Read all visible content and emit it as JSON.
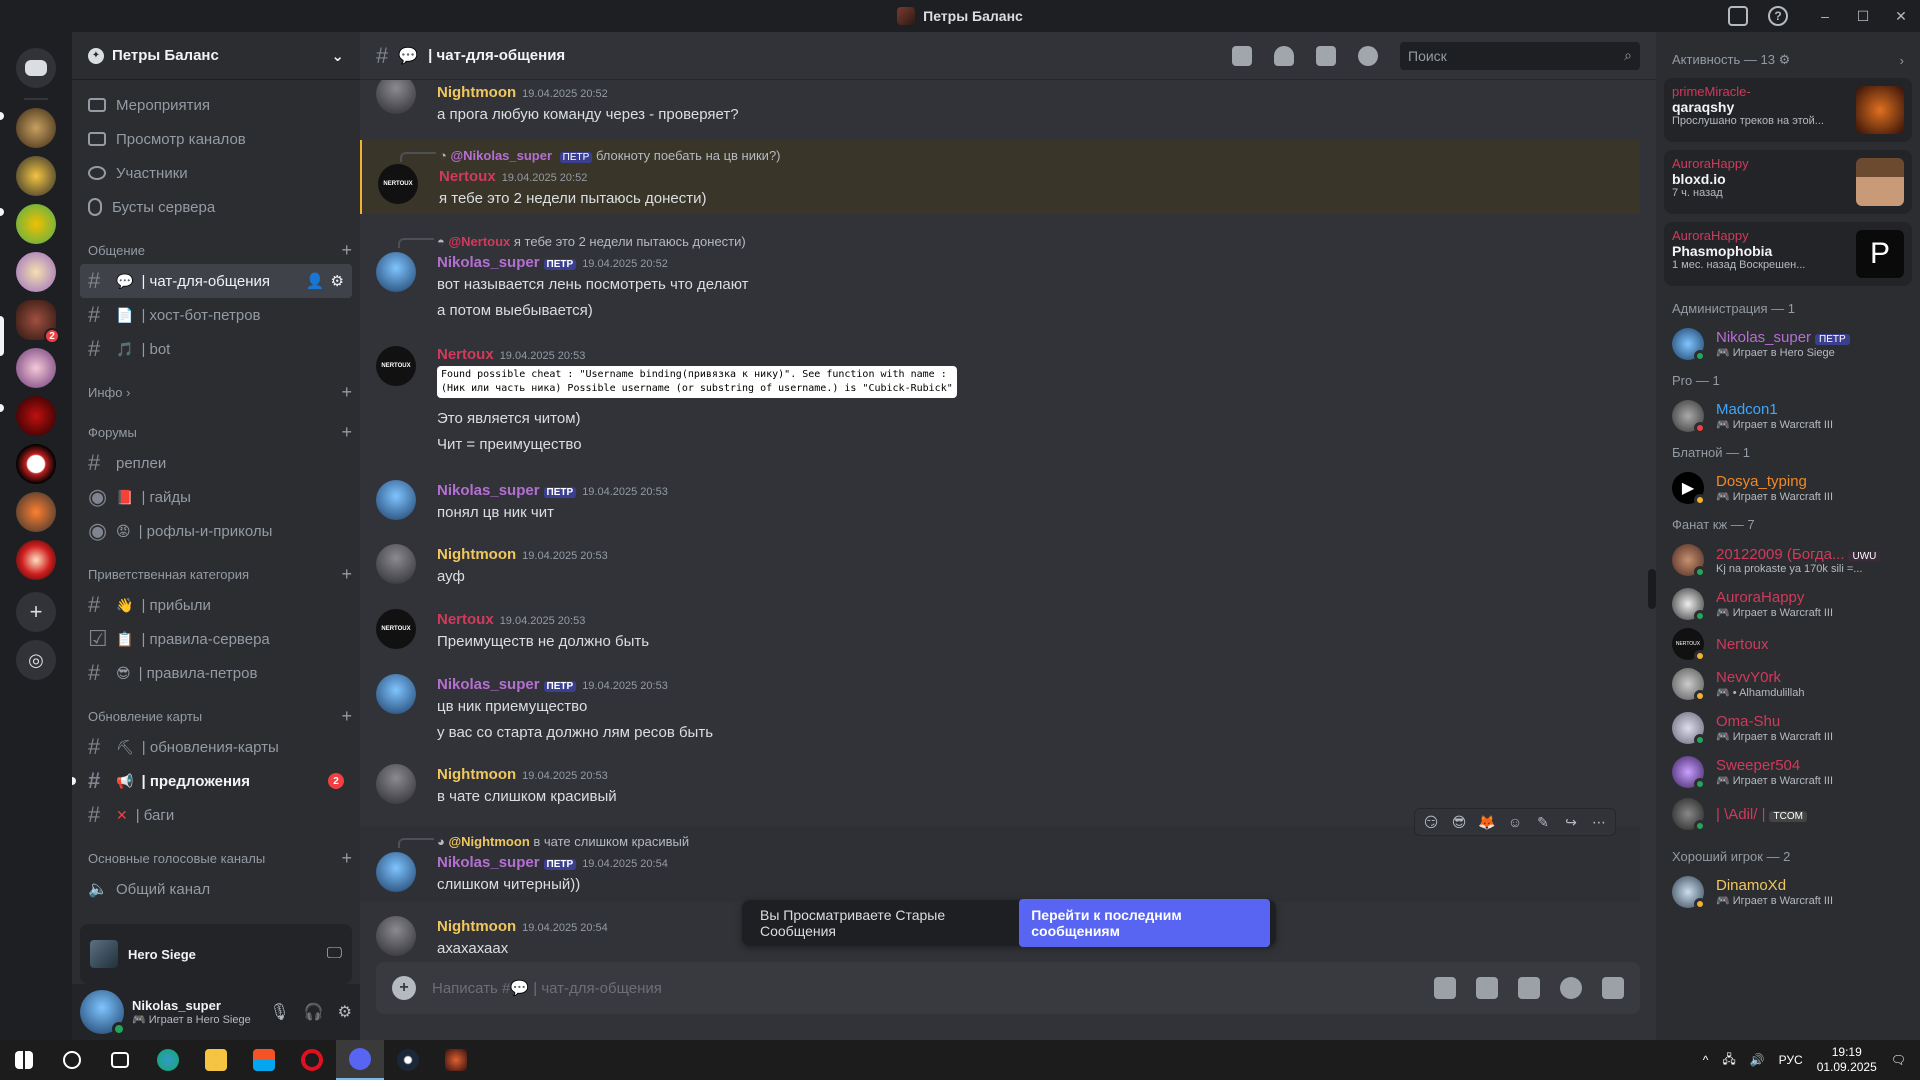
{
  "window": {
    "title": "Петры Баланс"
  },
  "guild": {
    "name": "Петры Баланс"
  },
  "nav": [
    "Мероприятия",
    "Просмотр каналов",
    "Участники",
    "Бусты сервера"
  ],
  "categories": {
    "c1": "Общение",
    "c2": "Инфо",
    "c3": "Форумы",
    "c4": "Приветственная категория",
    "c5": "Обновление карты",
    "c6": "Основные голосовые каналы"
  },
  "channels": {
    "chat": "| чат-для-общения",
    "host": "| хост-бот-петров",
    "bot": "| bot",
    "replays": "реплеи",
    "guides": "| гайды",
    "jokes": "| рофлы-и-приколы",
    "arrived": "| прибыли",
    "rules": "| правила-сервера",
    "rules_petrov": "| правила-петров",
    "map_updates": "| обновления-карты",
    "suggestions": "предложения",
    "suggestions_count": "2",
    "bugs": "| баги",
    "voice_general": "Общий канал"
  },
  "voice_bar": {
    "game": "Hero Siege"
  },
  "user": {
    "name": "Nikolas_super",
    "status": "Играет в Hero Siege"
  },
  "chat_header": {
    "channel": "| чат-для-общения",
    "search_placeholder": "Поиск"
  },
  "messages": [
    {
      "author": "Nightmoon",
      "time": "19.04.2025 20:52",
      "lines": [
        "а прога любую команду через - проверяет?"
      ]
    },
    {
      "reply_to": "@Nikolas_super",
      "reply_text": "блокноту поебать на цв ники?)",
      "author": "Nertoux",
      "time": "19.04.2025 20:52",
      "lines": [
        "я тебе это 2 недели пытаюсь донести)"
      ]
    },
    {
      "reply_to": "@Nertoux",
      "reply_text": "я тебе это 2 недели пытаюсь донести)",
      "author": "Nikolas_super",
      "time": "19.04.2025 20:52",
      "lines": [
        "вот называется лень посмотреть что делают",
        "а потом выебывается)"
      ]
    },
    {
      "author": "Nertoux",
      "time": "19.04.2025 20:53",
      "code": [
        "Found possible cheat : \"Username binding(привязка к нику)\". See function with name :",
        "(Ник или часть ника) Possible username (or substring of username.) is \"Cubick-Rubick\""
      ],
      "lines": [
        "Это является читом)",
        "Чит = преимущество"
      ]
    },
    {
      "author": "Nikolas_super",
      "time": "19.04.2025 20:53",
      "lines": [
        "понял цв ник чит"
      ]
    },
    {
      "author": "Nightmoon",
      "time": "19.04.2025 20:53",
      "lines": [
        "ауф"
      ]
    },
    {
      "author": "Nertoux",
      "time": "19.04.2025 20:53",
      "lines": [
        "Преимуществ не должно быть"
      ]
    },
    {
      "author": "Nikolas_super",
      "time": "19.04.2025 20:53",
      "lines": [
        "цв ник приемущество",
        "у вас со старта должно лям ресов быть"
      ]
    },
    {
      "author": "Nightmoon",
      "time": "19.04.2025 20:53",
      "lines": [
        "в чате слишком красивый"
      ]
    },
    {
      "reply_to": "@Nightmoon",
      "reply_text": "в чате слишком красивый",
      "author": "Nikolas_super",
      "time": "19.04.2025 20:54",
      "lines": [
        "слишком читерный))"
      ]
    },
    {
      "author": "Nightmoon",
      "time": "19.04.2025 20:54",
      "lines": [
        "ахахахаах"
      ]
    }
  ],
  "user_tag": "ПЕТР",
  "jump_bar": {
    "text": "Вы Просматриваете Старые Сообщения",
    "button": "Перейти к последним сообщениям"
  },
  "composer": {
    "prefix": "Написать #",
    "placeholder": "| чат-для-общения"
  },
  "members": {
    "activity_header": "Активность — 13",
    "activities": [
      {
        "user": "primeMiracle-",
        "title": "qaraqshy",
        "sub": "Прослушано треков на этой..."
      },
      {
        "user": "AuroraHappy",
        "title": "bloxd.io",
        "sub": "7 ч. назад"
      },
      {
        "user": "AuroraHappy",
        "title": "Phasmophobia",
        "sub": "1 мес. назад  Воскрешен..."
      }
    ],
    "sections": [
      {
        "title": "Администрация — 1",
        "items": [
          {
            "name": "Nikolas_super",
            "tag": "ПЕТР",
            "sub": "Играет в Hero Siege",
            "color": "#b56fd2"
          }
        ]
      },
      {
        "title": "Pro — 1",
        "items": [
          {
            "name": "Madcon1",
            "sub": "Играет в Warcraft III",
            "color": "#3ea6ff"
          }
        ]
      },
      {
        "title": "Блатной — 1",
        "items": [
          {
            "name": "Dosya_typing",
            "sub": "Играет в Warcraft III",
            "color": "#f08a24"
          }
        ]
      },
      {
        "title": "Фанат кж — 7",
        "items": [
          {
            "name": "20122009 (Богда...",
            "tag": "UWU",
            "sub": "Kj na prokaste ya 170k sili =...",
            "color": "#d13a5b"
          },
          {
            "name": "AuroraHappy",
            "sub": "Играет в Warcraft III",
            "color": "#d13a5b"
          },
          {
            "name": "Nertoux",
            "sub": "",
            "color": "#d13a5b"
          },
          {
            "name": "NevvY0rk",
            "sub": "Alhamdulillah",
            "color": "#d13a5b"
          },
          {
            "name": "Oma-Shu",
            "sub": "Играет в Warcraft III",
            "color": "#d13a5b"
          },
          {
            "name": "Sweeper504",
            "sub": "Играет в Warcraft III",
            "color": "#d13a5b"
          },
          {
            "name": "| \\Adil/ |",
            "tag": "TCOM",
            "sub": "",
            "color": "#d13a5b"
          }
        ]
      },
      {
        "title": "Хороший игрок — 2",
        "items": [
          {
            "name": "DinamoXd",
            "sub": "Играет в Warcraft III",
            "color": "#f0c75e"
          }
        ]
      }
    ]
  },
  "taskbar": {
    "lang": "РУС",
    "time": "19:19",
    "date": "01.09.2025"
  },
  "colors": {
    "accent": "#5865f2",
    "nightmoon": "#f0c75e",
    "nertoux": "#d13a5b",
    "nikolas": "#b56fd2"
  }
}
